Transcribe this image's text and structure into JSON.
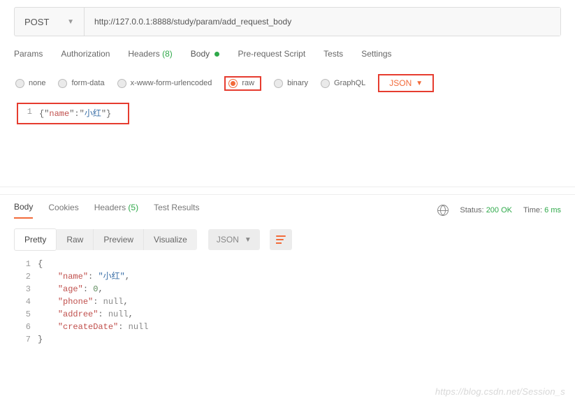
{
  "request": {
    "method": "POST",
    "url": "http://127.0.0.1:8888/study/param/add_request_body"
  },
  "tabs": {
    "params": "Params",
    "authorization": "Authorization",
    "headers_label": "Headers",
    "headers_count": "(8)",
    "body": "Body",
    "prerequest": "Pre-request Script",
    "tests": "Tests",
    "settings": "Settings"
  },
  "body_types": {
    "none": "none",
    "form_data": "form-data",
    "urlencoded": "x-www-form-urlencoded",
    "raw": "raw",
    "binary": "binary",
    "graphql": "GraphQL",
    "json_select": "JSON"
  },
  "request_body": {
    "line_no": "1",
    "open": "{",
    "q1": "\"",
    "key": "name",
    "q2": "\"",
    "colon": ":",
    "q3": "\"",
    "val": "小红",
    "q4": "\"",
    "close": "}"
  },
  "response_tabs": {
    "body": "Body",
    "cookies": "Cookies",
    "headers_label": "Headers",
    "headers_count": "(5)",
    "test_results": "Test Results"
  },
  "response_meta": {
    "status_label": "Status:",
    "status_value": "200 OK",
    "time_label": "Time:",
    "time_value": "6 ms"
  },
  "resp_toolbar": {
    "pretty": "Pretty",
    "raw": "Raw",
    "preview": "Preview",
    "visualize": "Visualize",
    "json": "JSON"
  },
  "response_body": {
    "l1": "1",
    "l2": "2",
    "l3": "3",
    "l4": "4",
    "l5": "5",
    "l6": "6",
    "l7": "7",
    "open": "{",
    "close": "}",
    "name_key": "\"name\"",
    "name_val": "\"小红\"",
    "age_key": "\"age\"",
    "age_val": "0",
    "phone_key": "\"phone\"",
    "phone_val": "null",
    "addree_key": "\"addree\"",
    "addree_val": "null",
    "createDate_key": "\"createDate\"",
    "createDate_val": "null",
    "colon": ": ",
    "comma": ",",
    "indent": "    "
  },
  "watermark": "https://blog.csdn.net/Session_s"
}
